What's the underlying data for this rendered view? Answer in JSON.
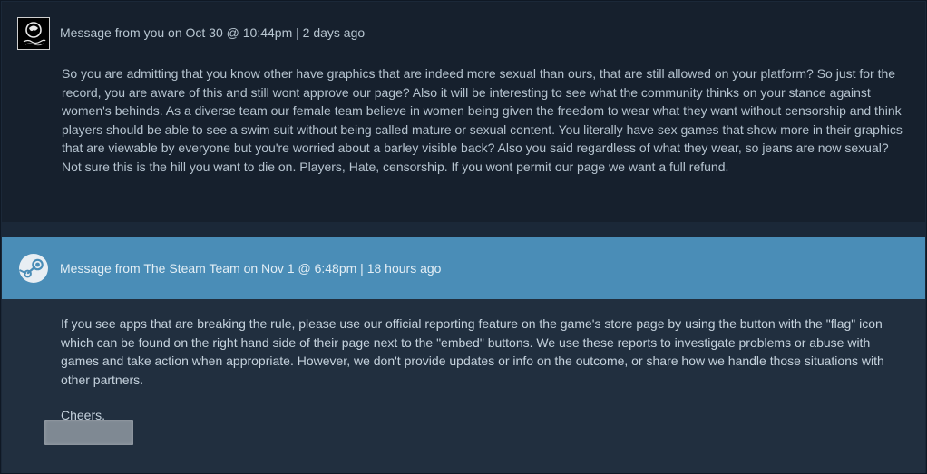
{
  "messages": [
    {
      "header": "Message from you on Oct 30 @ 10:44pm | 2 days ago",
      "avatar_icon": "user-avatar-logo",
      "body": "So you are admitting that you know other have graphics that are indeed more sexual than ours, that are still allowed on your platform? So just for the record, you are aware of this and still wont approve our page? Also it will be interesting to see what the community thinks on your stance against women's behinds. As a diverse team our female team believe in women being given the freedom to wear what they want without censorship and think players should be able to see a swim suit without being called mature or sexual content. You literally have sex games that show more in their graphics that are viewable by everyone but you're worried about a barley visible back? Also you said regardless of what they wear, so jeans are now sexual? Not sure this is the hill you want to die on. Players, Hate, censorship. If you wont permit our page we want a full refund."
    },
    {
      "header": "Message from The Steam Team on Nov 1 @ 6:48pm | 18 hours ago",
      "avatar_icon": "steam-logo-icon",
      "body": "If you see apps that are breaking the rule, please use our official reporting feature on the game's store page by using the button with the \"flag\" icon which can be found on the right hand side of their page next to the \"embed\" buttons. We use these reports to investigate problems or abuse with games and take action when appropriate. However, we don't provide updates or info on the outcome, or share how we handle those situations with other partners.",
      "signoff": "Cheers,"
    }
  ],
  "colors": {
    "page_bg": "#1b2838",
    "message_from_you_bg": "#16202d",
    "steam_header_bg": "#4a8db7",
    "steam_body_bg": "#212f3f"
  }
}
